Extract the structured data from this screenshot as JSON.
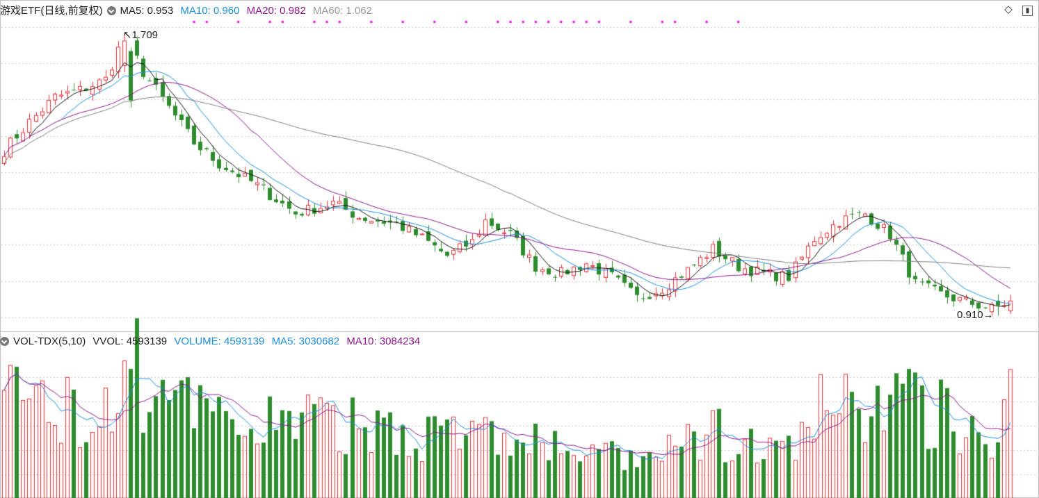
{
  "header": {
    "title": "游戏ETF(日线,前复权)",
    "ma5": "MA5: 0.953",
    "ma10": "MA10: 0.960",
    "ma20": "MA20: 0.982",
    "ma60": "MA60: 1.062"
  },
  "vol_header": {
    "title": "VOL-TDX(5,10)",
    "vvol": "VVOL: 4593139",
    "volume": "VOLUME: 4593139",
    "ma5": "MA5: 3030682",
    "ma10": "MA10: 3084234"
  },
  "annotations": {
    "high": "1.709",
    "low": "0.910"
  },
  "colors": {
    "up": "#e8333a",
    "down": "#2e8b2e",
    "ma5": "#111111",
    "ma10": "#1e90e0",
    "ma20": "#8b1a8b",
    "ma60": "#808080",
    "signal": "#ff00ff",
    "grid": "#c8c8c8",
    "header_gray": "#999999"
  },
  "chart_data": {
    "type": "candlestick",
    "count": 160,
    "price_range": [
      0.88,
      1.73
    ],
    "volume_max": 5000000,
    "price_waypoints": [
      [
        0,
        1.38
      ],
      [
        4,
        1.46
      ],
      [
        8,
        1.53
      ],
      [
        12,
        1.55
      ],
      [
        16,
        1.58
      ],
      [
        19,
        1.709
      ],
      [
        22,
        1.6
      ],
      [
        26,
        1.5
      ],
      [
        30,
        1.4
      ],
      [
        34,
        1.34
      ],
      [
        40,
        1.28
      ],
      [
        46,
        1.2
      ],
      [
        52,
        1.23
      ],
      [
        56,
        1.19
      ],
      [
        62,
        1.17
      ],
      [
        66,
        1.13
      ],
      [
        70,
        1.08
      ],
      [
        74,
        1.12
      ],
      [
        76,
        1.18
      ],
      [
        80,
        1.14
      ],
      [
        84,
        1.05
      ],
      [
        88,
        1.03
      ],
      [
        92,
        1.06
      ],
      [
        96,
        1.02
      ],
      [
        100,
        0.96
      ],
      [
        104,
        0.99
      ],
      [
        108,
        1.04
      ],
      [
        112,
        1.1
      ],
      [
        116,
        1.05
      ],
      [
        120,
        1.03
      ],
      [
        124,
        1.02
      ],
      [
        128,
        1.13
      ],
      [
        132,
        1.18
      ],
      [
        136,
        1.2
      ],
      [
        140,
        1.14
      ],
      [
        144,
        1.0
      ],
      [
        148,
        0.97
      ],
      [
        152,
        0.95
      ],
      [
        156,
        0.93
      ],
      [
        159,
        0.953
      ]
    ],
    "volume_waypoints": [
      [
        0,
        3200000
      ],
      [
        4,
        3600000
      ],
      [
        8,
        3200000
      ],
      [
        12,
        3100000
      ],
      [
        16,
        3400000
      ],
      [
        19,
        4900000
      ],
      [
        22,
        4200000
      ],
      [
        26,
        3500000
      ],
      [
        30,
        2900000
      ],
      [
        36,
        2600000
      ],
      [
        44,
        2900000
      ],
      [
        52,
        2500000
      ],
      [
        60,
        2600000
      ],
      [
        68,
        2300000
      ],
      [
        76,
        2200000
      ],
      [
        84,
        1900000
      ],
      [
        92,
        1600000
      ],
      [
        98,
        1300000
      ],
      [
        104,
        1400000
      ],
      [
        108,
        2100000
      ],
      [
        112,
        2300000
      ],
      [
        118,
        1800000
      ],
      [
        124,
        1600000
      ],
      [
        128,
        3000000
      ],
      [
        132,
        3200000
      ],
      [
        140,
        3400000
      ],
      [
        144,
        3300000
      ],
      [
        148,
        3000000
      ],
      [
        152,
        2400000
      ],
      [
        156,
        2000000
      ],
      [
        159,
        4593139
      ]
    ],
    "signal_dots_count": 26
  }
}
